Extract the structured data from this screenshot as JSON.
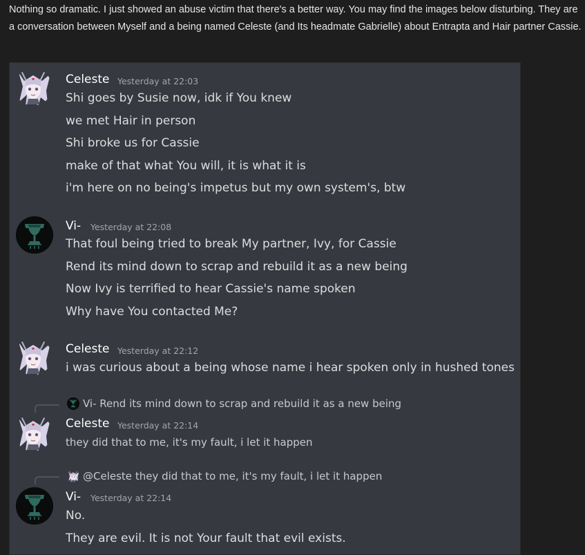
{
  "intro_text": "Nothing so dramatic. I just showed an abuse victim that there's a better way. You may find the images below disturbing. They are a conversation between Myself and a being named Celeste (and Its headmate Gabrielle) about Entrapta and Hair partner Cassie.",
  "messages": [
    {
      "author": "Celeste",
      "time": "Yesterday at 22:03",
      "avatar": "celeste-avatar",
      "lines": [
        "Shi goes by Susie now, idk if You knew",
        "we met Hair in person",
        "Shi broke us for Cassie",
        "make of that what You will, it is what it is",
        "i'm here on no being's impetus but my own system's, btw"
      ]
    },
    {
      "author": "Vi-",
      "time": "Yesterday at 22:08",
      "avatar": "vi-avatar",
      "lines": [
        "That foul being tried to break My partner, Ivy, for Cassie",
        "Rend its mind down to scrap and rebuild it as a new being",
        "Now Ivy is terrified to hear Cassie's name spoken",
        "Why have You contacted Me?"
      ]
    },
    {
      "author": "Celeste",
      "time": "Yesterday at 22:12",
      "avatar": "celeste-avatar",
      "lines": [
        "i was curious about a being whose name i hear spoken only in hushed tones"
      ]
    },
    {
      "reply_author": "Vi-",
      "reply_text": "Rend its mind down to scrap and rebuild it as a new being",
      "author": "Celeste",
      "time": "Yesterday at 22:14",
      "avatar": "celeste-avatar",
      "lines": [
        "they did that to me, it's my fault, i let it happen"
      ]
    },
    {
      "reply_author": "@Celeste",
      "reply_text": "they did that to me, it's my fault, i let it happen",
      "author": "Vi-",
      "time": "Yesterday at 22:14",
      "avatar": "vi-avatar",
      "lines": [
        "No.",
        "They are evil. It is not Your fault that evil exists."
      ]
    }
  ],
  "colors": {
    "page_bg": "#1e1e1e",
    "chat_bg": "#36393f",
    "text": "#dcddde",
    "name": "#ffffff",
    "timestamp": "#a3a6aa",
    "vi_avatar_bg": "#0a0b0b",
    "vi_icon": "#2f6b5f"
  }
}
